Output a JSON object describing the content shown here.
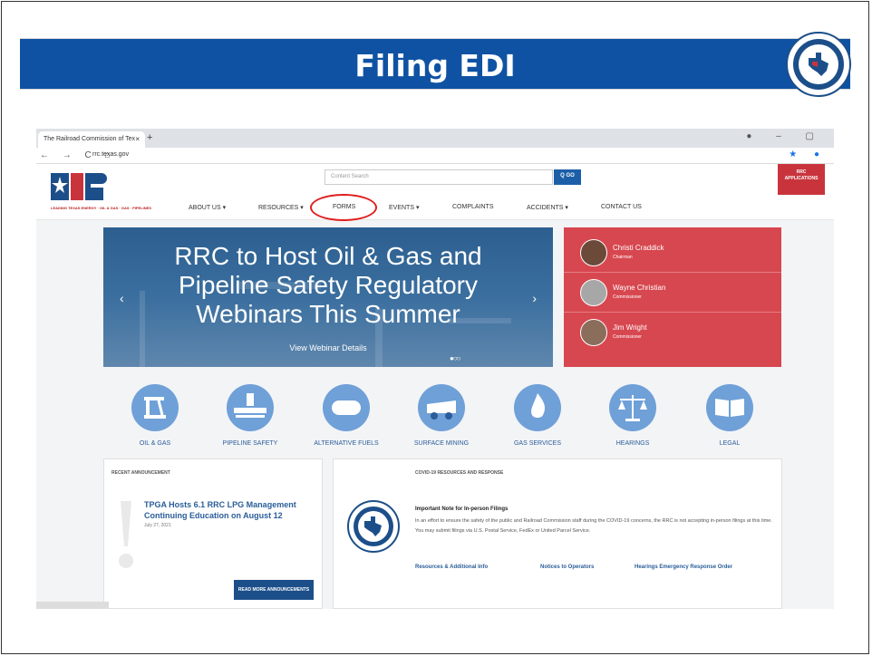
{
  "slide": {
    "title": "Filing EDI"
  },
  "browser": {
    "tab_title": "The Railroad Commission of Tex",
    "tab_close": "×",
    "new_tab": "+",
    "url": "rrc.texas.gov",
    "nav_buttons": "← → C ⌂",
    "window_controls": "● – ▢",
    "addr_right": "★ ●"
  },
  "site": {
    "logo_tagline": "LEADING TEXAS ENERGY · OIL & GAS · GAS · PIPELINES",
    "search_placeholder": "Content Search",
    "go_label": "Q GO",
    "apps_label_1": "RRC",
    "apps_label_2": "APPLICATIONS",
    "nav": [
      "ABOUT US ▾",
      "RESOURCES ▾",
      "FORMS",
      "EVENTS ▾",
      "COMPLAINTS",
      "ACCIDENTS ▾",
      "CONTACT US"
    ]
  },
  "hero": {
    "headline": "RRC to Host Oil & Gas and Pipeline Safety Regulatory Webinars This Summer",
    "link": "View Webinar Details",
    "prev": "‹",
    "next": "›",
    "dots": "●○○"
  },
  "commissioners": [
    {
      "name": "Christi Craddick",
      "title": "Chairman"
    },
    {
      "name": "Wayne Christian",
      "title": "Commissioner"
    },
    {
      "name": "Jim Wright",
      "title": "Commissioner"
    }
  ],
  "categories": [
    {
      "label": "OIL & GAS",
      "icon": "oil-pump-icon"
    },
    {
      "label": "PIPELINE SAFETY",
      "icon": "pipeline-icon"
    },
    {
      "label": "ALTERNATIVE FUELS",
      "icon": "fuel-tank-icon"
    },
    {
      "label": "SURFACE MINING",
      "icon": "mining-truck-icon"
    },
    {
      "label": "GAS SERVICES",
      "icon": "flame-icon"
    },
    {
      "label": "HEARINGS",
      "icon": "scales-icon"
    },
    {
      "label": "LEGAL",
      "icon": "book-icon"
    }
  ],
  "announcements": {
    "header": "RECENT ANNOUNCEMENT",
    "title": "TPGA Hosts 6.1 RRC LPG Management Continuing Education on August 12",
    "date": "July 27, 2021",
    "read_more": "READ MORE ANNOUNCEMENTS"
  },
  "covid": {
    "header": "COVID-19 RESOURCES AND RESPONSE",
    "note_title": "Important Note for In-person Filings",
    "note_body": "In an effort to ensure the safety of the public and Railroad Commission staff during the COVID-19 concerns, the RRC is not accepting in-person filings at this time. You may submit filings via U.S. Postal Service, FedEx or United Parcel Service.",
    "links": [
      "Resources & Additional Info",
      "Notices to Operators",
      "Hearings Emergency Response Order"
    ]
  },
  "colors": {
    "band": "#0f52a3",
    "accent_red": "#d7474f",
    "link_blue": "#2a5d99",
    "icon_blue": "#6fa0d8"
  }
}
